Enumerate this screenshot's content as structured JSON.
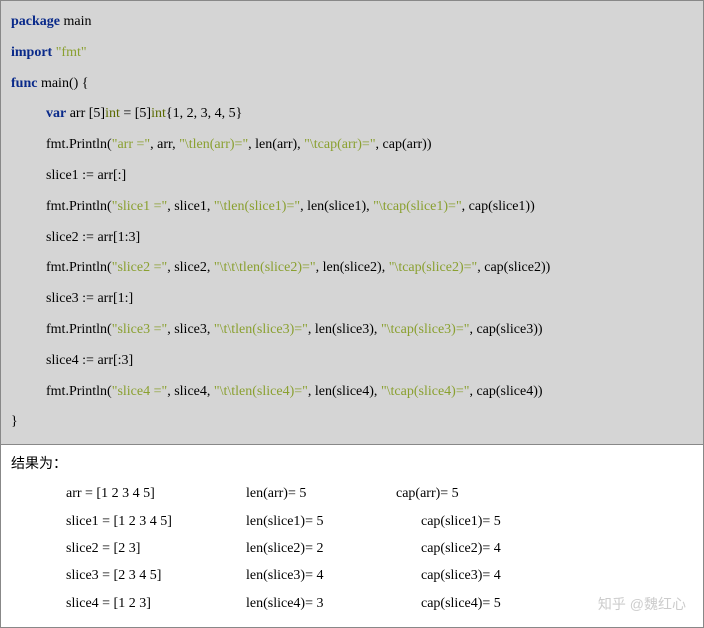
{
  "code": {
    "l1_kw": "package",
    "l1_rest": " main",
    "l2_kw": "import",
    "l2_sp": " ",
    "l2_str": "\"fmt\"",
    "l3_kw": "func",
    "l3_rest": " main() {",
    "l4_kw": "var",
    "l4_a": " arr [5]",
    "l4_typ": "int",
    "l4_b": " = [5]",
    "l4_typ2": "int",
    "l4_c": "{1, 2, 3, 4, 5}",
    "l5_a": "fmt.Println(",
    "l5_s1": "\"arr =\"",
    "l5_b": ", arr, ",
    "l5_s2": "\"\\tlen(arr)=\"",
    "l5_c": ", len(arr), ",
    "l5_s3": "\"\\tcap(arr)=\"",
    "l5_d": ", cap(arr))",
    "l6": "slice1 := arr[:]",
    "l7_a": "fmt.Println(",
    "l7_s1": "\"slice1 =\"",
    "l7_b": ", slice1, ",
    "l7_s2": "\"\\tlen(slice1)=\"",
    "l7_c": ", len(slice1), ",
    "l7_s3": "\"\\tcap(slice1)=\"",
    "l7_d": ", cap(slice1))",
    "l8": "slice2 := arr[1:3]",
    "l9_a": "fmt.Println(",
    "l9_s1": "\"slice2 =\"",
    "l9_b": ", slice2, ",
    "l9_s2": "\"\\t\\t\\tlen(slice2)=\"",
    "l9_c": ", len(slice2), ",
    "l9_s3": "\"\\tcap(slice2)=\"",
    "l9_d": ", cap(slice2))",
    "l10": "slice3 := arr[1:]",
    "l11_a": "fmt.Println(",
    "l11_s1": "\"slice3 =\"",
    "l11_b": ", slice3, ",
    "l11_s2": "\"\\t\\tlen(slice3)=\"",
    "l11_c": ", len(slice3), ",
    "l11_s3": "\"\\tcap(slice3)=\"",
    "l11_d": ", cap(slice3))",
    "l12": "slice4 := arr[:3]",
    "l13_a": "fmt.Println(",
    "l13_s1": "\"slice4 =\"",
    "l13_b": ", slice4, ",
    "l13_s2": "\"\\t\\tlen(slice4)=\"",
    "l13_c": ", len(slice4), ",
    "l13_s3": "\"\\tcap(slice4)=\"",
    "l13_d": ", cap(slice4))",
    "l14": "}"
  },
  "result": {
    "label": "结果为：",
    "rows": [
      {
        "c1": "arr = [1 2 3 4 5]",
        "c2": "len(arr)= 5",
        "c3": "cap(arr)= 5"
      },
      {
        "c1": "slice1 = [1 2 3 4 5]",
        "c2": "len(slice1)= 5",
        "c3": "cap(slice1)= 5"
      },
      {
        "c1": "slice2 = [2 3]",
        "c2": "len(slice2)= 2",
        "c3": "cap(slice2)= 4"
      },
      {
        "c1": "slice3 = [2 3 4 5]",
        "c2": "len(slice3)= 4",
        "c3": "cap(slice3)= 4"
      },
      {
        "c1": "slice4 = [1 2 3]",
        "c2": "len(slice4)= 3",
        "c3": "cap(slice4)= 5"
      }
    ]
  },
  "watermark": "知乎 @魏红心"
}
